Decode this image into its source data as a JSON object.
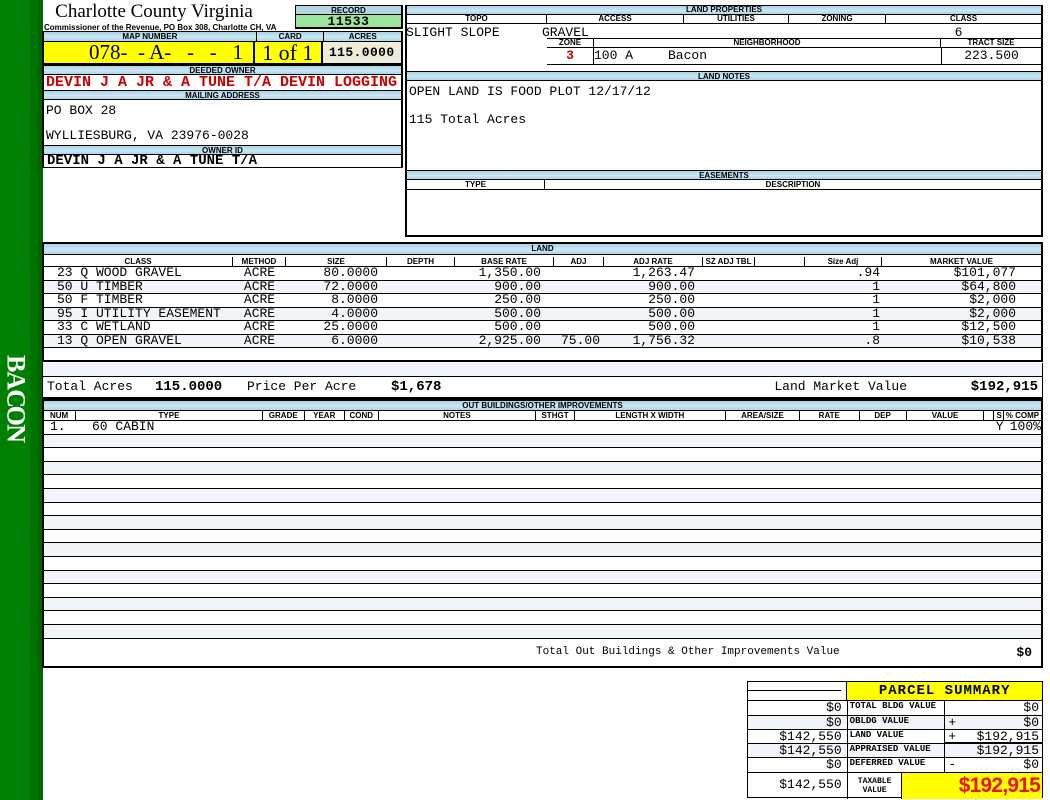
{
  "colors": {
    "band_blue": "#b4d7e6",
    "record_green": "#9de49d",
    "acres_beige": "#eeecd9",
    "highlight_yellow": "#ffff00",
    "owner_red": "#cc0000",
    "taxable_red": "#ee1111",
    "sidebar_green": "#008000",
    "row_tint": "#f1f4f9"
  },
  "sidebar": {
    "text": "BACON",
    "letters": [
      "B",
      "A",
      "C",
      "O",
      "N"
    ]
  },
  "header": {
    "county": "Charlotte County Virginia",
    "commissioner": "Commissioner of the Revenue, PO Box 308, Charlotte CH, VA",
    "record_label": "RECORD",
    "record": "11533",
    "map_number_label": "MAP NUMBER",
    "map_number": "078-  - A-   -   -   1",
    "card_label": "CARD",
    "card": "1 of 1",
    "acres_label": "ACRES",
    "acres": "115.0000",
    "deeded_owner_label": "DEEDED OWNER",
    "deeded_owner": "DEVIN J A JR & A TUNE T/A DEVIN LOGGING",
    "mailing_address_label": "MAILING ADDRESS",
    "mailing_address_line1": "PO BOX 28",
    "mailing_address_line2": "WYLLIESBURG, VA 23976-0028",
    "owner_id_label": "OWNER ID",
    "owner_id": "DEVIN J A JR & A TUNE T/A"
  },
  "land_properties": {
    "title": "LAND PROPERTIES",
    "topo_label": "TOPO",
    "topo": "SLIGHT SLOPE",
    "access_label": "ACCESS",
    "access": "GRAVEL",
    "utilities_label": "UTILITIES",
    "utilities": "",
    "zoning_label": "ZONING",
    "zoning": "",
    "class_label": "CLASS",
    "class": "6",
    "zone_label": "ZONE",
    "zone": "3",
    "neighborhood_label": "NEIGHBORHOOD",
    "neighborhood_code": "100 A",
    "neighborhood_name": "Bacon",
    "tract_size_label": "TRACT SIZE",
    "tract_size": "223.500"
  },
  "land_notes": {
    "title": "LAND NOTES",
    "line1": "OPEN LAND IS FOOD PLOT 12/17/12",
    "line2": "115 Total Acres"
  },
  "easements": {
    "title": "EASEMENTS",
    "type_label": "TYPE",
    "description_label": "DESCRIPTION"
  },
  "land": {
    "title": "LAND",
    "headers": [
      "CLASS",
      "METHOD",
      "SIZE",
      "DEPTH",
      "BASE RATE",
      "ADJ",
      "ADJ RATE",
      "SZ ADJ TBL",
      "",
      "Size Adj",
      "MARKET VALUE"
    ],
    "rows": [
      {
        "class": "23 Q WOOD GRAVEL",
        "method": "ACRE",
        "size": "80.0000",
        "depth": "",
        "base_rate": "1,350.00",
        "adj": "",
        "adj_rate": "1,263.47",
        "sz_adj_tbl": "",
        "size_adj": ".94",
        "market_value": "$101,077"
      },
      {
        "class": "50 U TIMBER",
        "method": "ACRE",
        "size": "72.0000",
        "depth": "",
        "base_rate": "900.00",
        "adj": "",
        "adj_rate": "900.00",
        "sz_adj_tbl": "",
        "size_adj": "1",
        "market_value": "$64,800"
      },
      {
        "class": "50 F TIMBER",
        "method": "ACRE",
        "size": "8.0000",
        "depth": "",
        "base_rate": "250.00",
        "adj": "",
        "adj_rate": "250.00",
        "sz_adj_tbl": "",
        "size_adj": "1",
        "market_value": "$2,000"
      },
      {
        "class": "95 I UTILITY EASEMENT",
        "method": "ACRE",
        "size": "4.0000",
        "depth": "",
        "base_rate": "500.00",
        "adj": "",
        "adj_rate": "500.00",
        "sz_adj_tbl": "",
        "size_adj": "1",
        "market_value": "$2,000"
      },
      {
        "class": "33 C WETLAND",
        "method": "ACRE",
        "size": "25.0000",
        "depth": "",
        "base_rate": "500.00",
        "adj": "",
        "adj_rate": "500.00",
        "sz_adj_tbl": "",
        "size_adj": "1",
        "market_value": "$12,500"
      },
      {
        "class": "13 Q OPEN GRAVEL",
        "method": "ACRE",
        "size": "6.0000",
        "depth": "",
        "base_rate": "2,925.00",
        "adj": "75.00",
        "adj_rate": "1,756.32",
        "sz_adj_tbl": "",
        "size_adj": ".8",
        "market_value": "$10,538"
      }
    ],
    "total_acres_label": "Total Acres",
    "total_acres": "115.0000",
    "price_per_acre_label": "Price Per Acre",
    "price_per_acre": "$1,678",
    "land_market_value_label": "Land Market Value",
    "land_market_value": "$192,915"
  },
  "out_buildings": {
    "title": "OUT BUILDINGS/OTHER IMPROVEMENTS",
    "headers": [
      "NUM",
      "TYPE",
      "GRADE",
      "YEAR",
      "COND",
      "NOTES",
      "STHGT",
      "LENGTH X WIDTH",
      "AREA/SIZE",
      "RATE",
      "DEP",
      "VALUE",
      "",
      "S",
      "% COMP"
    ],
    "rows": [
      {
        "num": "1.",
        "type": "60 CABIN",
        "grade": "",
        "year": "",
        "cond": "",
        "notes": "",
        "sthgt": "",
        "length_x_width": "",
        "area_size": "",
        "rate": "",
        "dep": "",
        "value": "",
        "s": "Y",
        "pct_comp": "100%"
      }
    ],
    "total_label": "Total Out Buildings & Other Improvements Value",
    "total": "$0"
  },
  "parcel_summary": {
    "title": "PARCEL SUMMARY",
    "rows": [
      {
        "prev": "$0",
        "label": "TOTAL BLDG VALUE",
        "sign": "",
        "value": "$0"
      },
      {
        "prev": "$0",
        "label": "OBLDG VALUE",
        "sign": "+",
        "value": "$0"
      },
      {
        "prev": "$142,550",
        "label": "LAND VALUE",
        "sign": "+",
        "value": "$192,915"
      },
      {
        "prev": "$142,550",
        "label": "APPRAISED VALUE",
        "sign": "",
        "value": "$192,915"
      },
      {
        "prev": "$0",
        "label": "DEFERRED VALUE",
        "sign": "-",
        "value": "$0"
      }
    ],
    "taxable": {
      "prev": "$142,550",
      "label_line1": "TAXABLE",
      "label_line2": "VALUE",
      "value": "$192,915"
    }
  }
}
